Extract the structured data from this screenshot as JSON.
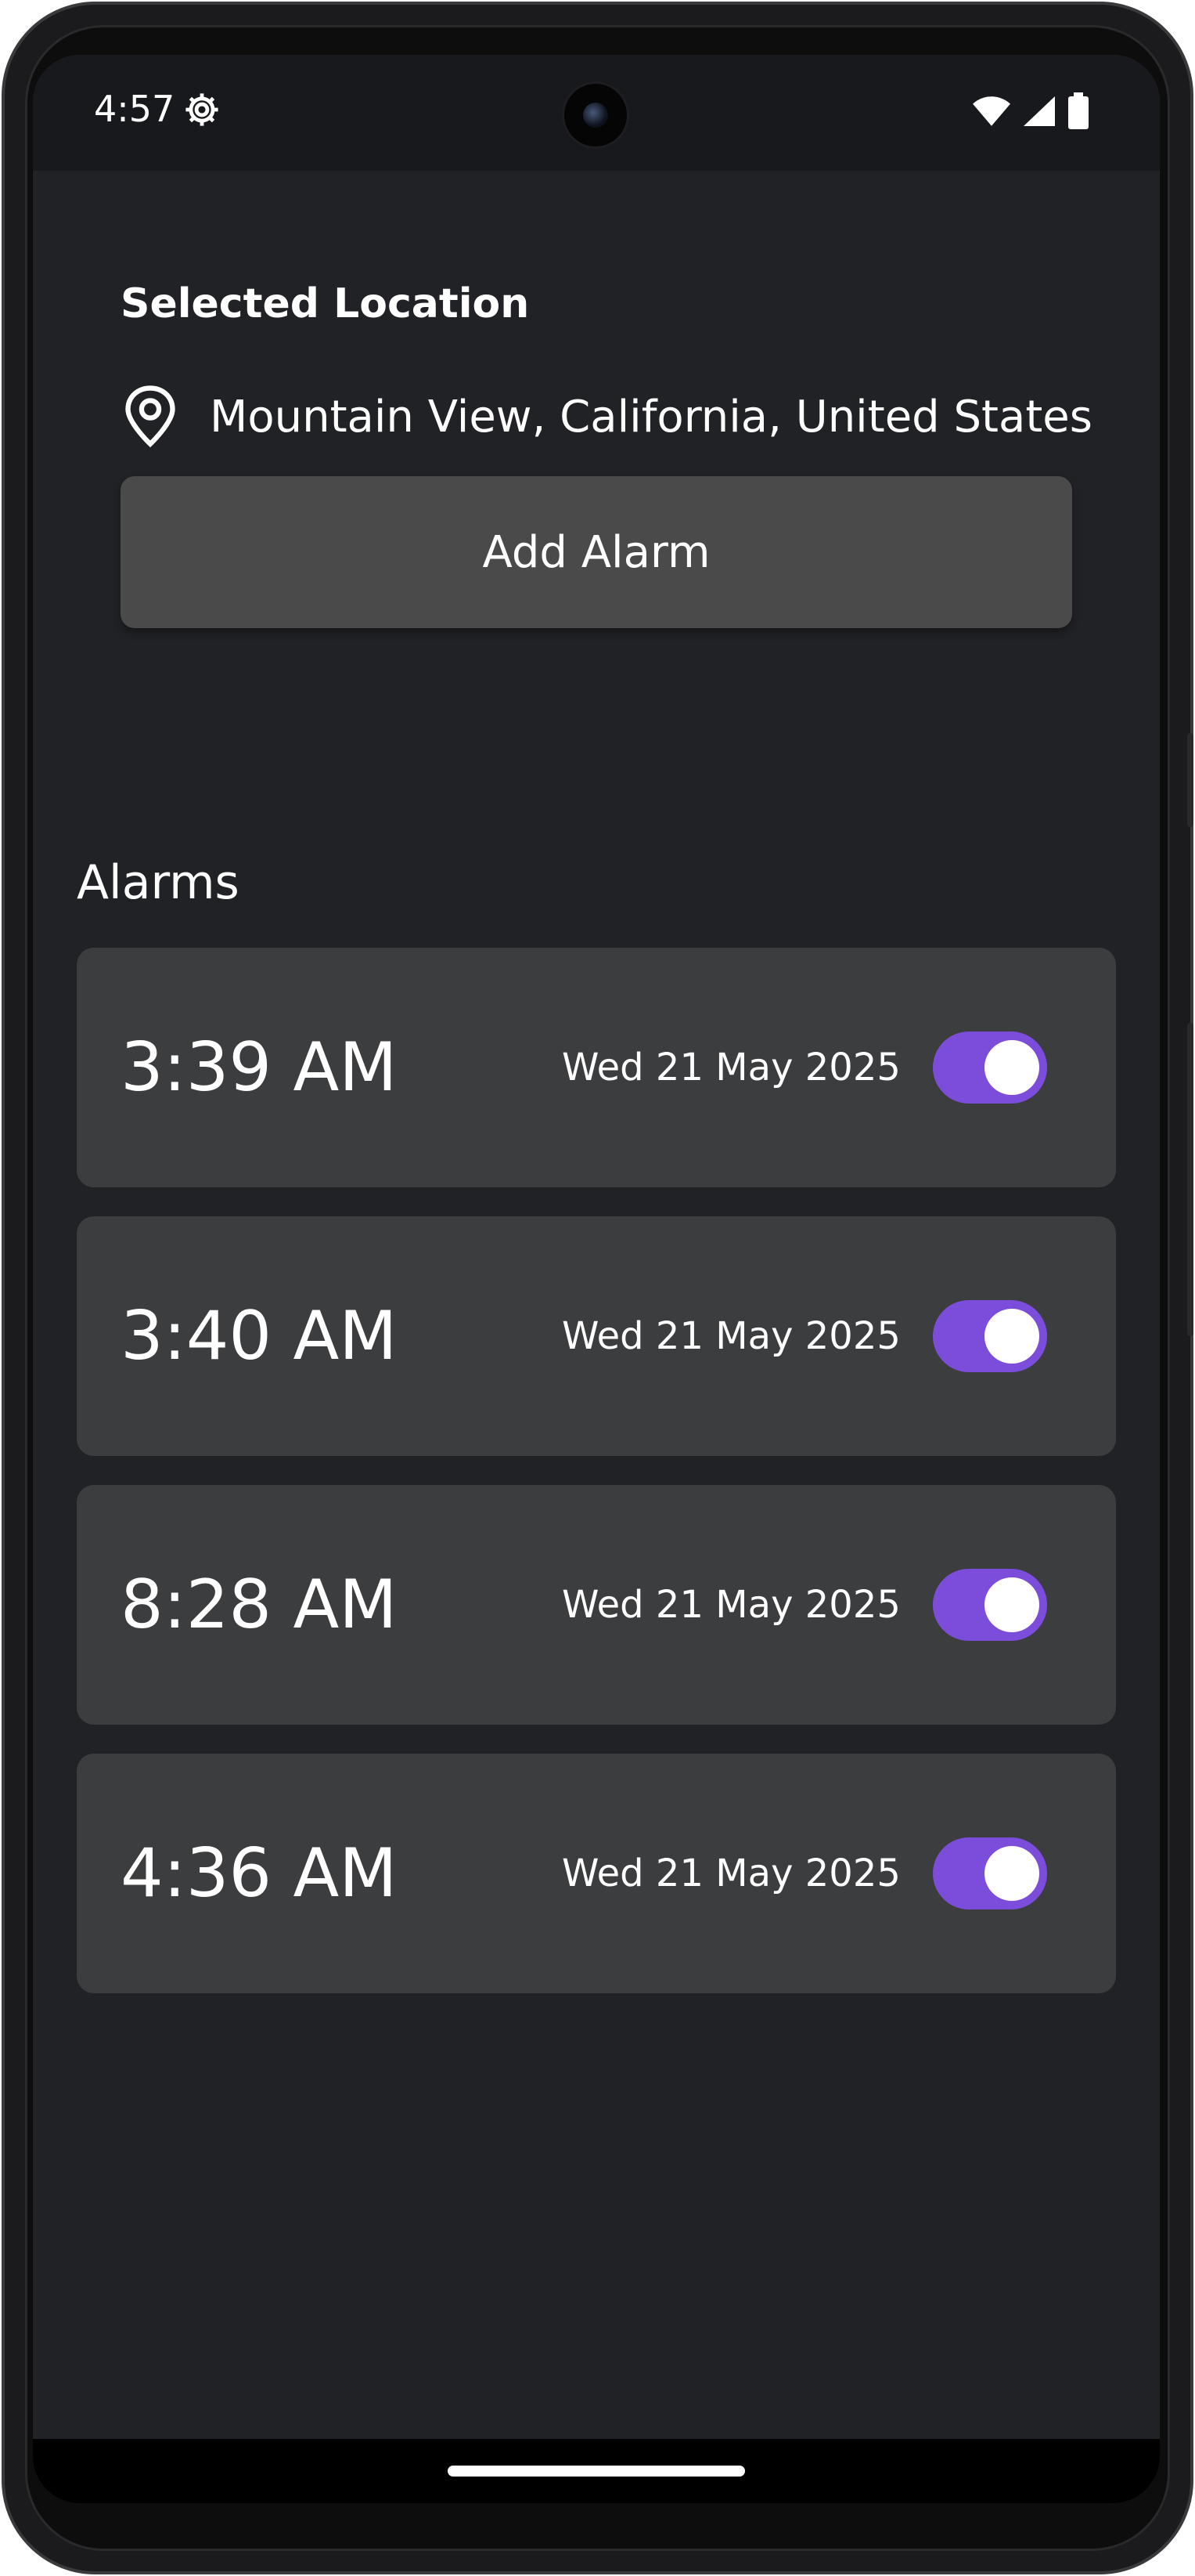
{
  "status_bar": {
    "time": "4:57",
    "icons": [
      "gear-icon",
      "wifi-icon",
      "signal-icon",
      "battery-icon"
    ]
  },
  "location": {
    "title": "Selected Location",
    "icon": "location-pin-icon",
    "value": "Mountain View, California, United States"
  },
  "add_alarm": {
    "label": "Add Alarm"
  },
  "alarms": {
    "heading": "Alarms",
    "items": [
      {
        "time": "3:39 AM",
        "date": "Wed 21 May 2025",
        "enabled": true
      },
      {
        "time": "3:40 AM",
        "date": "Wed 21 May 2025",
        "enabled": true
      },
      {
        "time": "8:28 AM",
        "date": "Wed 21 May 2025",
        "enabled": true
      },
      {
        "time": "4:36 AM",
        "date": "Wed 21 May 2025",
        "enabled": true
      }
    ]
  },
  "colors": {
    "background": "#212226",
    "card": "#3c3d3f",
    "button": "#4a4a4a",
    "toggle_accent": "#7c4ddb"
  }
}
